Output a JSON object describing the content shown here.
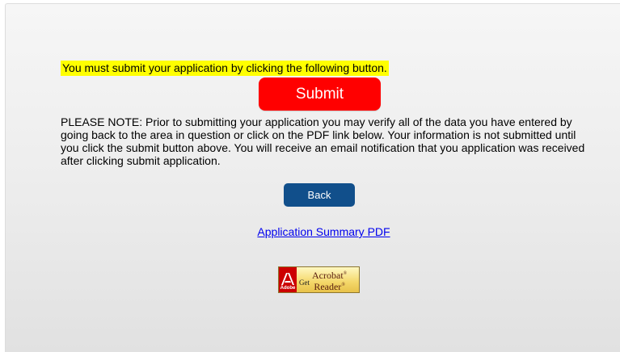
{
  "notice": {
    "text": "You must submit your application by clicking the following button."
  },
  "actions": {
    "submit_label": "Submit",
    "back_label": "Back"
  },
  "note": {
    "text": "PLEASE NOTE: Prior to submitting your application you may verify all of the data you have entered by going back to the area in question or click on the PDF link below. Your information is not submitted until you click the submit button above. You will receive an email notification that you application was received after clicking submit application."
  },
  "links": {
    "pdf_summary": "Application Summary PDF"
  },
  "acrobat": {
    "icon": "adobe-logo-icon",
    "adobe": "Adobe",
    "get": "Get",
    "line1": "Acrobat",
    "line2": "Reader",
    "mark": "®"
  },
  "colors": {
    "highlight": "#ffff00",
    "submit": "#ff0000",
    "back": "#114f8b",
    "link": "#0000ee"
  }
}
